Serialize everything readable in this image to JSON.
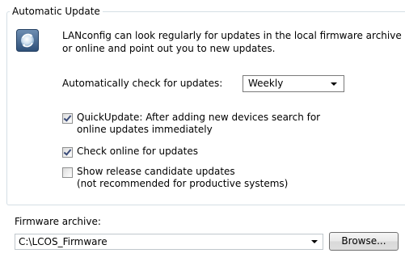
{
  "group": {
    "title": "Automatic Update"
  },
  "info": {
    "icon": "update-globe-icon",
    "line1": "LANconfig can look regularly for updates in the local firmware archive",
    "line2": "or online and point out you to new updates."
  },
  "auto_check": {
    "label": "Automatically check for updates:",
    "selected": "Weekly"
  },
  "options": {
    "quickupdate": {
      "checked": true,
      "line1": "QuickUpdate: After adding new devices search for",
      "line2": "online updates immediately"
    },
    "online": {
      "checked": true,
      "line1": "Check online for updates"
    },
    "release_candidate": {
      "checked": false,
      "line1": "Show release candidate updates",
      "line2": "(not recommended for productive systems)"
    }
  },
  "archive": {
    "label": "Firmware archive:",
    "path": "C:\\LCOS_Firmware",
    "browse_label": "Browse..."
  },
  "colors": {
    "accent": "#3a4b78",
    "groupbox_border": "#d5dfe5"
  }
}
